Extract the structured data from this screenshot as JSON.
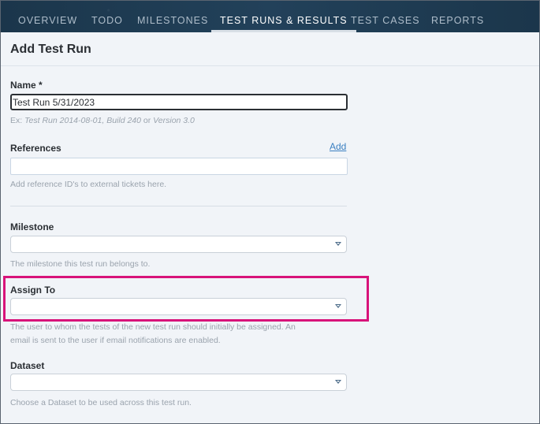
{
  "nav": {
    "tabs": [
      {
        "label": "OVERVIEW"
      },
      {
        "label": "TODO"
      },
      {
        "label": "MILESTONES"
      },
      {
        "label": "TEST RUNS & RESULTS"
      },
      {
        "label": "TEST CASES"
      },
      {
        "label": "REPORTS"
      }
    ],
    "active": "TEST RUNS & RESULTS"
  },
  "header": {
    "title": "Add Test Run"
  },
  "form": {
    "name": {
      "label": "Name *",
      "value": "Test Run 5/31/2023",
      "hint_prefix": "Ex: ",
      "hint_example": "Test Run 2014-08-01, Build 240",
      "hint_or": " or ",
      "hint_example2": "Version 3.0"
    },
    "references": {
      "label": "References",
      "add_link": "Add",
      "value": "",
      "hint": "Add reference ID's to external tickets here."
    },
    "milestone": {
      "label": "Milestone",
      "value": "",
      "hint": "The milestone this test run belongs to."
    },
    "assign_to": {
      "label": "Assign To",
      "value": "",
      "hint_line1": "The user to whom the tests of the new test run should initially be assigned. An",
      "hint_line2": "email is sent to the user if email notifications are enabled."
    },
    "dataset": {
      "label": "Dataset",
      "value": "",
      "hint": "Choose a Dataset to be used across this test run."
    }
  },
  "colors": {
    "nav_bg": "#1d3a50",
    "highlight": "#d8137a",
    "link": "#3a7fc1"
  }
}
